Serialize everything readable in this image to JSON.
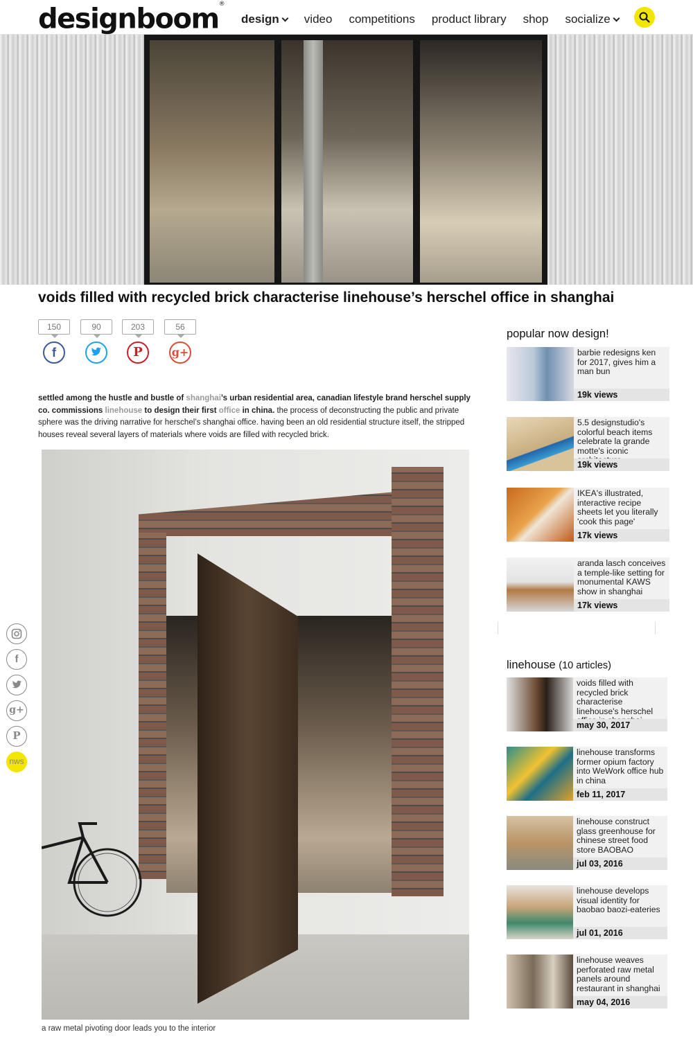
{
  "header": {
    "logo": "designboom",
    "logo_mark": "®",
    "nav": [
      "design",
      "video",
      "competitions",
      "product library",
      "shop",
      "socialize"
    ]
  },
  "article": {
    "title": "voids filled with recycled brick characterise linehouse’s herschel office in shanghai",
    "share_counts": [
      "150",
      "90",
      "203",
      "56"
    ],
    "share_icons": [
      "facebook-icon",
      "twitter-icon",
      "pinterest-icon",
      "google-plus-icon"
    ],
    "body": {
      "p1": "settled among the hustle and bustle of ",
      "l1": "shanghai",
      "p2": "’s urban residential area, canadian lifestyle brand herschel supply co. commissions ",
      "l2": "linehouse",
      "p3": " to design their first ",
      "l3": "office",
      "p4": " in china.",
      "p5": " the process of deconstructing the public and private sphere was the driving narrative for herschel’s shanghai office. having been an old residential structure itself, the stripped houses reveal several layers of materials where voids are filled with recycled brick."
    },
    "caption": "a raw metal pivoting door leads you to the interior"
  },
  "social_rail": [
    "instagram-icon",
    "facebook-icon",
    "twitter-icon",
    "google-plus-icon",
    "pinterest-icon",
    "nws"
  ],
  "popular": {
    "heading": "popular now design!",
    "items": [
      {
        "title": "barbie redesigns ken for 2017, gives him a man bun",
        "meta": "19k views"
      },
      {
        "title": "5.5 designstudio's colorful beach items celebrate la grande motte's iconic architecture",
        "meta": "19k views"
      },
      {
        "title": "IKEA's illustrated, interactive recipe sheets let you literally 'cook this page'",
        "meta": "17k views"
      },
      {
        "title": "aranda lasch conceives a temple-like setting for monumental KAWS show in shanghai",
        "meta": "17k views"
      }
    ]
  },
  "related": {
    "heading": "linehouse",
    "count": "(10 articles)",
    "items": [
      {
        "title": "voids filled with recycled brick characterise linehouse's herschel office in shanghai",
        "meta": "may 30, 2017"
      },
      {
        "title": "linehouse transforms former opium factory into WeWork office hub in china",
        "meta": "feb 11, 2017"
      },
      {
        "title": "linehouse construct glass greenhouse for chinese street food store BAOBAO",
        "meta": "jul 03, 2016"
      },
      {
        "title": "linehouse develops visual identity for baobao baozi-eateries",
        "meta": "jul 01, 2016"
      },
      {
        "title": "linehouse weaves perforated raw metal panels around restaurant in shanghai",
        "meta": "may 04, 2016"
      }
    ]
  },
  "colors": {
    "accent": "#f2e600",
    "facebook": "#3b5998",
    "twitter": "#1da1f2",
    "pinterest": "#cb2027",
    "google_plus": "#dd4b39"
  }
}
